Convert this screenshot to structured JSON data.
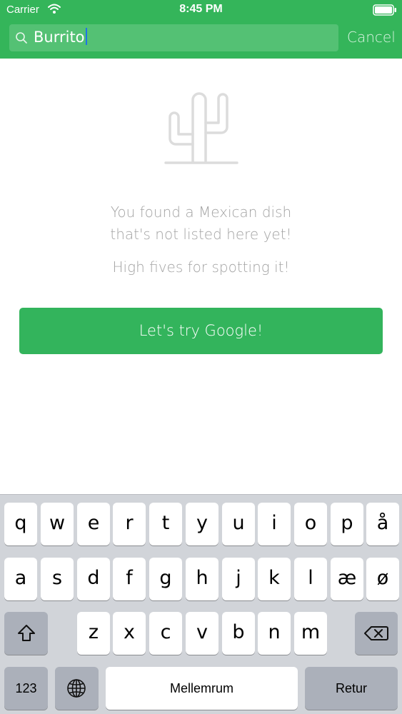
{
  "status_bar": {
    "carrier": "Carrier",
    "time": "8:45 PM"
  },
  "search": {
    "query": "Burrito",
    "cancel_label": "Cancel"
  },
  "empty_state": {
    "icon": "cactus-icon",
    "message_line1": "You found a Mexican dish",
    "message_line2": "that's not listed here yet!",
    "message_line3": "High fives for spotting it!",
    "button_label": "Let's try Google!"
  },
  "keyboard": {
    "row1": [
      "q",
      "w",
      "e",
      "r",
      "t",
      "y",
      "u",
      "i",
      "o",
      "p",
      "å"
    ],
    "row2": [
      "a",
      "s",
      "d",
      "f",
      "g",
      "h",
      "j",
      "k",
      "l",
      "æ",
      "ø"
    ],
    "row3": [
      "z",
      "x",
      "c",
      "v",
      "b",
      "n",
      "m"
    ],
    "numbers_label": "123",
    "space_label": "Mellemrum",
    "return_label": "Retur",
    "shift_icon": "shift-icon",
    "backspace_icon": "backspace-icon",
    "globe_icon": "globe-icon"
  },
  "colors": {
    "brand_green": "#34b55a",
    "button_green": "#33b45c",
    "message_gray": "#a3a3a3",
    "keyboard_bg": "#d1d4d9"
  }
}
